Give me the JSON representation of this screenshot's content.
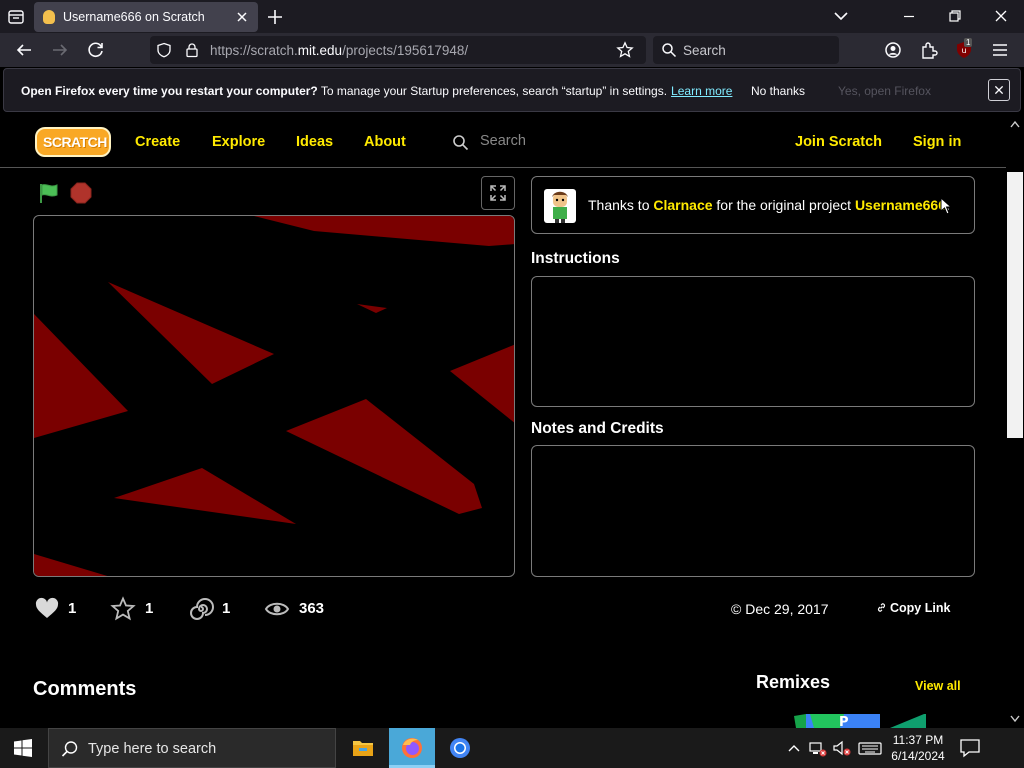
{
  "browser": {
    "tab_title": "Username666 on Scratch",
    "url_prefix": "https://scratch.",
    "url_domain": "mit.edu",
    "url_path": "/projects/195617948/",
    "search_placeholder": "Search",
    "extension_badge": "1"
  },
  "notification": {
    "bold": "Open Firefox every time you restart your computer?",
    "text": " To manage your Startup preferences, search “startup” in settings.",
    "learn_more": "Learn more",
    "no_thanks": "No thanks",
    "yes_open": "Yes, open Firefox"
  },
  "scratch_nav": {
    "logo": "SCRATCH",
    "create": "Create",
    "explore": "Explore",
    "ideas": "Ideas",
    "about": "About",
    "search_placeholder": "Search",
    "join": "Join Scratch",
    "sign_in": "Sign in"
  },
  "project": {
    "credit_prefix": "Thanks to ",
    "credit_user": "Clarnace",
    "credit_mid": " for the original project ",
    "credit_project": "Username666",
    "credit_suffix": ".",
    "instructions_title": "Instructions",
    "notes_title": "Notes and Credits",
    "loves": "1",
    "favorites": "1",
    "remixes_count": "1",
    "views": "363",
    "date": "Dec 29, 2017",
    "copy_link": "Copy Link",
    "comments_title": "Comments",
    "remixes_title": "Remixes",
    "view_all": "View all"
  },
  "taskbar": {
    "search_placeholder": "Type here to search",
    "time": "11:37 PM",
    "date": "6/14/2024"
  },
  "colors": {
    "accent_yellow": "#ffea00",
    "stage_red": "#7a0000",
    "flag_green": "#4cbf56",
    "stop_red": "#b0332b"
  }
}
